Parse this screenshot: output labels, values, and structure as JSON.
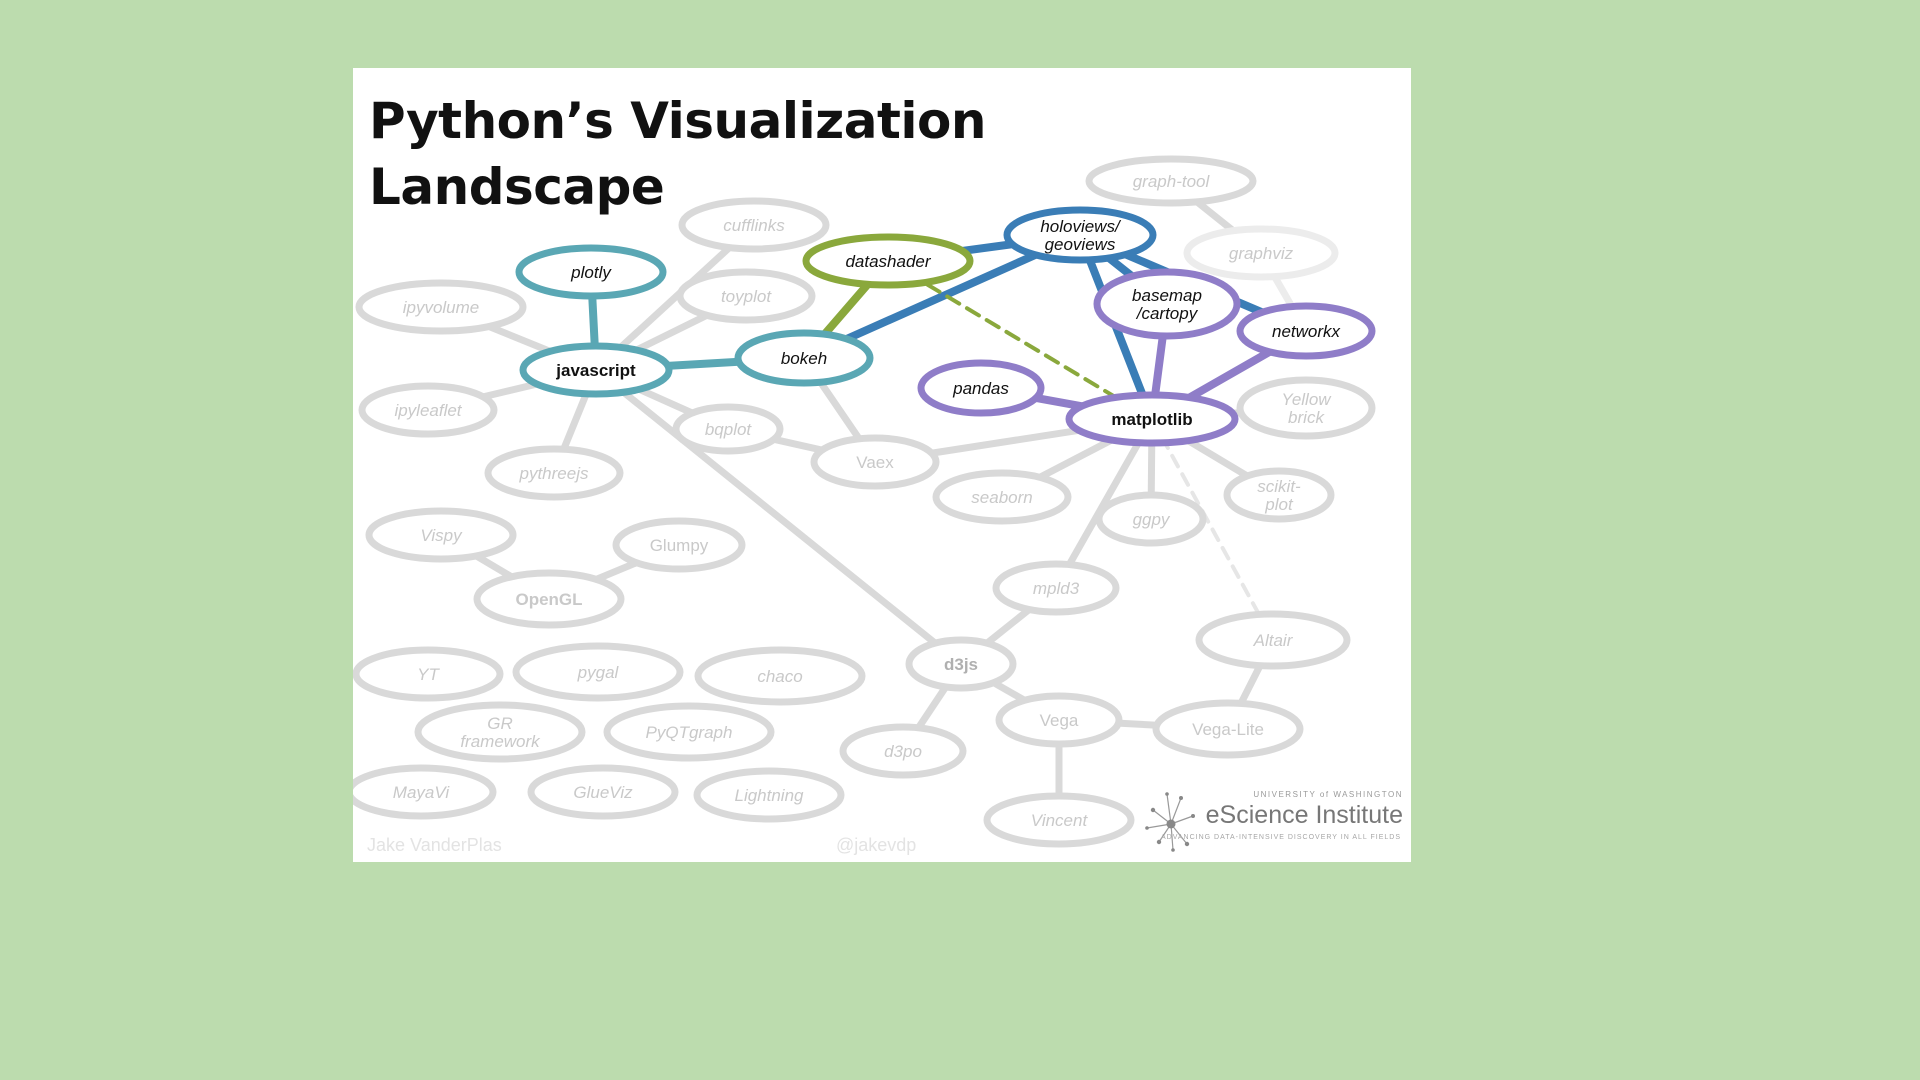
{
  "title_line1": "Python’s Visualization",
  "title_line2": "Landscape",
  "credit_left": "Jake VanderPlas",
  "credit_mid": "@jakevdp",
  "logo": {
    "institution_top": "UNIVERSITY of WASHINGTON",
    "name": "eScience Institute",
    "tagline": "ADVANCING DATA-INTENSIVE DISCOVERY IN ALL FIELDS"
  },
  "nodes": [
    {
      "id": "graph-tool",
      "lines": [
        "graph-tool"
      ],
      "style": "faded"
    },
    {
      "id": "graphviz",
      "lines": [
        "graphviz"
      ],
      "style": "very-faded"
    },
    {
      "id": "cufflinks",
      "lines": [
        "cufflinks"
      ],
      "style": "faded"
    },
    {
      "id": "plotly",
      "lines": [
        "plotly"
      ],
      "style": "teal"
    },
    {
      "id": "ipyvolume",
      "lines": [
        "ipyvolume"
      ],
      "style": "faded"
    },
    {
      "id": "toyplot",
      "lines": [
        "toyplot"
      ],
      "style": "faded"
    },
    {
      "id": "datashader",
      "lines": [
        "datashader"
      ],
      "style": "green"
    },
    {
      "id": "holoviews",
      "lines": [
        "holoviews/",
        "geoviews"
      ],
      "style": "blue"
    },
    {
      "id": "basemap",
      "lines": [
        "basemap",
        "/cartopy"
      ],
      "style": "purple"
    },
    {
      "id": "networkx",
      "lines": [
        "networkx"
      ],
      "style": "purple"
    },
    {
      "id": "javascript",
      "lines": [
        "javascript"
      ],
      "style": "teal-bold"
    },
    {
      "id": "bokeh",
      "lines": [
        "bokeh"
      ],
      "style": "teal"
    },
    {
      "id": "pandas",
      "lines": [
        "pandas"
      ],
      "style": "purple"
    },
    {
      "id": "matplotlib",
      "lines": [
        "matplotlib"
      ],
      "style": "purple-bold"
    },
    {
      "id": "yellowbrick",
      "lines": [
        "Yellow",
        "brick"
      ],
      "style": "faded"
    },
    {
      "id": "ipyleaflet",
      "lines": [
        "ipyleaflet"
      ],
      "style": "faded"
    },
    {
      "id": "bqplot",
      "lines": [
        "bqplot"
      ],
      "style": "faded"
    },
    {
      "id": "vaex",
      "lines": [
        "Vaex"
      ],
      "style": "faded-plain"
    },
    {
      "id": "pythreejs",
      "lines": [
        "pythreejs"
      ],
      "style": "faded"
    },
    {
      "id": "seaborn",
      "lines": [
        "seaborn"
      ],
      "style": "faded"
    },
    {
      "id": "scikit-plot",
      "lines": [
        "scikit-",
        "plot"
      ],
      "style": "faded"
    },
    {
      "id": "ggpy",
      "lines": [
        "ggpy"
      ],
      "style": "faded"
    },
    {
      "id": "vispy",
      "lines": [
        "Vispy"
      ],
      "style": "faded"
    },
    {
      "id": "glumpy",
      "lines": [
        "Glumpy"
      ],
      "style": "faded-plain"
    },
    {
      "id": "opengl",
      "lines": [
        "OpenGL"
      ],
      "style": "faded-bold"
    },
    {
      "id": "mpld3",
      "lines": [
        "mpld3"
      ],
      "style": "faded"
    },
    {
      "id": "altair",
      "lines": [
        "Altair"
      ],
      "style": "faded"
    },
    {
      "id": "yt",
      "lines": [
        "YT"
      ],
      "style": "faded"
    },
    {
      "id": "pygal",
      "lines": [
        "pygal"
      ],
      "style": "faded"
    },
    {
      "id": "chaco",
      "lines": [
        "chaco"
      ],
      "style": "faded"
    },
    {
      "id": "d3js",
      "lines": [
        "d3js"
      ],
      "style": "faded-bold-dark"
    },
    {
      "id": "gr",
      "lines": [
        "GR",
        "framework"
      ],
      "style": "faded"
    },
    {
      "id": "pyqtgraph",
      "lines": [
        "PyQTgraph"
      ],
      "style": "faded"
    },
    {
      "id": "vega",
      "lines": [
        "Vega"
      ],
      "style": "faded-plain"
    },
    {
      "id": "vega-lite",
      "lines": [
        "Vega-Lite"
      ],
      "style": "faded-plain"
    },
    {
      "id": "d3po",
      "lines": [
        "d3po"
      ],
      "style": "faded"
    },
    {
      "id": "mayavi",
      "lines": [
        "MayaVi"
      ],
      "style": "faded"
    },
    {
      "id": "glueviz",
      "lines": [
        "GlueViz"
      ],
      "style": "faded"
    },
    {
      "id": "lightning",
      "lines": [
        "Lightning"
      ],
      "style": "faded"
    },
    {
      "id": "vincent",
      "lines": [
        "Vincent"
      ],
      "style": "faded"
    }
  ],
  "edges": [
    {
      "from": "plotly",
      "to": "javascript",
      "style": "teal"
    },
    {
      "from": "javascript",
      "to": "bokeh",
      "style": "teal"
    },
    {
      "from": "datashader",
      "to": "bokeh",
      "style": "green"
    },
    {
      "from": "datashader",
      "to": "holoviews",
      "style": "blue"
    },
    {
      "from": "holoviews",
      "to": "bokeh",
      "style": "blue"
    },
    {
      "from": "holoviews",
      "to": "matplotlib",
      "style": "blue"
    },
    {
      "from": "holoviews",
      "to": "basemap",
      "style": "blue"
    },
    {
      "from": "holoviews",
      "to": "networkx",
      "style": "blue"
    },
    {
      "from": "datashader",
      "to": "matplotlib",
      "style": "green-dashed"
    },
    {
      "from": "basemap",
      "to": "matplotlib",
      "style": "purple"
    },
    {
      "from": "networkx",
      "to": "matplotlib",
      "style": "purple"
    },
    {
      "from": "pandas",
      "to": "matplotlib",
      "style": "purple"
    },
    {
      "from": "javascript",
      "to": "ipyvolume",
      "style": "gray"
    },
    {
      "from": "javascript",
      "to": "ipyleaflet",
      "style": "gray"
    },
    {
      "from": "javascript",
      "to": "pythreejs",
      "style": "gray"
    },
    {
      "from": "javascript",
      "to": "bqplot",
      "style": "gray"
    },
    {
      "from": "javascript",
      "to": "toyplot",
      "style": "gray"
    },
    {
      "from": "javascript",
      "to": "cufflinks",
      "style": "gray"
    },
    {
      "from": "javascript",
      "to": "d3js",
      "style": "gray"
    },
    {
      "from": "bokeh",
      "to": "vaex",
      "style": "gray"
    },
    {
      "from": "bqplot",
      "to": "vaex",
      "style": "gray"
    },
    {
      "from": "vaex",
      "to": "matplotlib",
      "style": "gray"
    },
    {
      "from": "graph-tool",
      "to": "graphviz",
      "style": "gray"
    },
    {
      "from": "graphviz",
      "to": "networkx",
      "style": "very-faded"
    },
    {
      "from": "matplotlib",
      "to": "yellowbrick",
      "style": "gray"
    },
    {
      "from": "matplotlib",
      "to": "scikit-plot",
      "style": "gray"
    },
    {
      "from": "matplotlib",
      "to": "seaborn",
      "style": "gray"
    },
    {
      "from": "matplotlib",
      "to": "ggpy",
      "style": "gray"
    },
    {
      "from": "matplotlib",
      "to": "mpld3",
      "style": "gray"
    },
    {
      "from": "matplotlib",
      "to": "altair",
      "style": "gray-dashed"
    },
    {
      "from": "mpld3",
      "to": "d3js",
      "style": "gray"
    },
    {
      "from": "d3js",
      "to": "d3po",
      "style": "gray"
    },
    {
      "from": "d3js",
      "to": "vega",
      "style": "gray"
    },
    {
      "from": "vega",
      "to": "vega-lite",
      "style": "gray"
    },
    {
      "from": "vega",
      "to": "vincent",
      "style": "gray"
    },
    {
      "from": "vega-lite",
      "to": "altair",
      "style": "gray"
    },
    {
      "from": "vispy",
      "to": "opengl",
      "style": "gray"
    },
    {
      "from": "glumpy",
      "to": "opengl",
      "style": "gray"
    }
  ],
  "colors": {
    "teal": "#5aa7b4",
    "green": "#8aa83c",
    "blue": "#3a7db6",
    "purple": "#8f7dc8",
    "gray": "#d9d9d9",
    "very_faded": "#ececec",
    "background": "#bcdcae"
  }
}
